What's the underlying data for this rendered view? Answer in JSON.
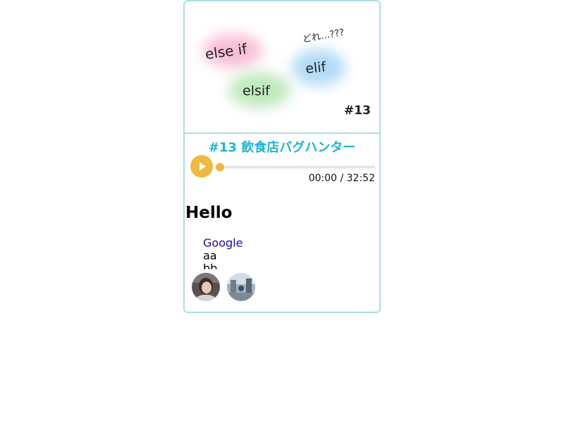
{
  "cover": {
    "labels": {
      "else_if": "else if",
      "elsif": "elsif",
      "elif": "elif",
      "question": "どれ…???",
      "episode": "#13"
    },
    "blob_colors": {
      "pink": "#f7a9c8",
      "green": "#a9e2a6",
      "blue": "#9fd1f5"
    }
  },
  "episode": {
    "title": "#13 飲食店バグハンター"
  },
  "player": {
    "time": "00:00 / 32:52",
    "progress": 0,
    "accent": "#f0b93f"
  },
  "content": {
    "heading": "Hello",
    "items": [
      {
        "text": "Google",
        "link": true
      },
      {
        "text": "aa",
        "link": false
      },
      {
        "text": "bb",
        "link": false
      }
    ]
  },
  "colors": {
    "border": "#a8e0e3",
    "title": "#1fb3d6",
    "link": "#1a0dab"
  }
}
